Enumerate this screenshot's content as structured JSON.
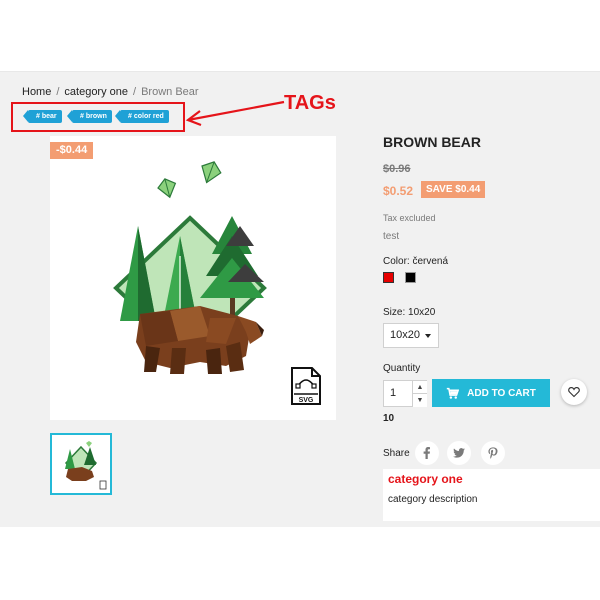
{
  "breadcrumb": {
    "items": [
      "Home",
      "category one",
      "Brown Bear"
    ],
    "separator": "/"
  },
  "tags": [
    {
      "label": "bear"
    },
    {
      "label": "brown"
    },
    {
      "label": "color red"
    }
  ],
  "annotation": {
    "label": "TAGs",
    "color": "#e5141a"
  },
  "product": {
    "title": "BROWN BEAR",
    "discount_badge": "-$0.44",
    "old_price": "$0.96",
    "new_price": "$0.52",
    "save_badge": "SAVE $0.44",
    "tax_note": "Tax excluded",
    "variant_text": "test",
    "color_label": "Color: červená",
    "colors": [
      "#e60000",
      "#000000"
    ],
    "size_label": "Size: 10x20",
    "size_value": "10x20",
    "quantity_label": "Quantity",
    "quantity_value": "1",
    "add_to_cart": "ADD TO CART",
    "stock": "10",
    "file_badge": "SVG"
  },
  "share": {
    "label": "Share",
    "facebook": "f",
    "twitter": "t",
    "pinterest": "p"
  },
  "category": {
    "title": "category one",
    "description": "category description"
  },
  "colors": {
    "accent": "#24b9d7",
    "discount": "#f39d72",
    "tag": "#1fa1d6",
    "annotation": "#e5141a"
  }
}
